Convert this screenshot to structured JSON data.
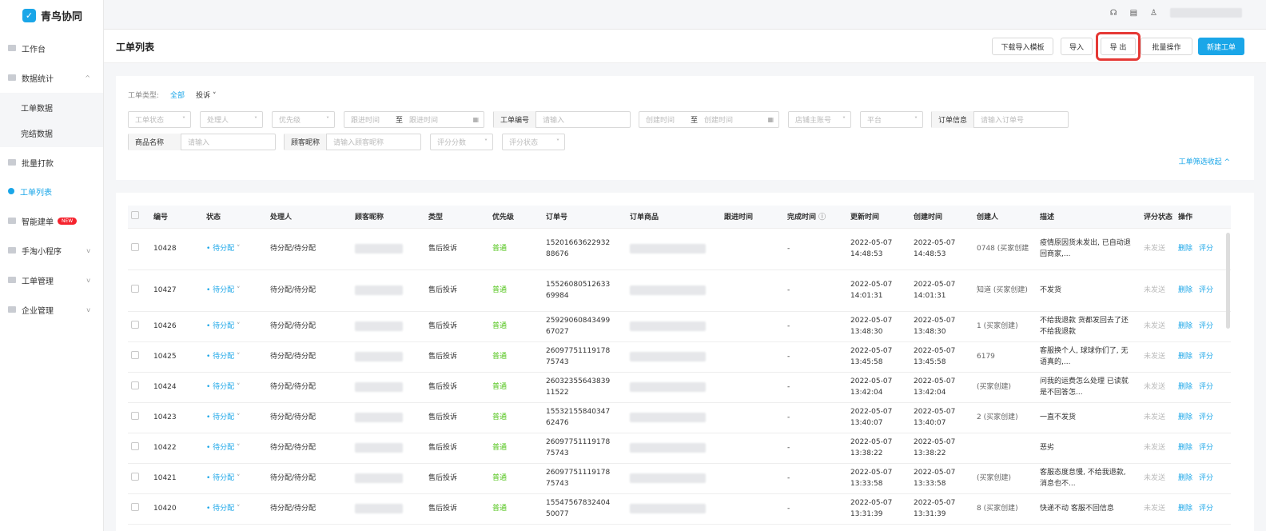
{
  "app": {
    "title": "青鸟协同",
    "logo_char": "✓"
  },
  "sidebar": {
    "items": [
      {
        "label": "工作台"
      },
      {
        "label": "数据统计",
        "chev": "^"
      },
      {
        "label": "工单数据"
      },
      {
        "label": "完结数据"
      },
      {
        "label": "批量打款"
      },
      {
        "label": "工单列表"
      },
      {
        "label": "智能建单",
        "badge": "NEW"
      },
      {
        "label": "手淘小程序",
        "chev": "v"
      },
      {
        "label": "工单管理",
        "chev": "v"
      },
      {
        "label": "企业管理",
        "chev": "v"
      }
    ]
  },
  "header": {
    "title": "工单列表",
    "buttons": {
      "download": "下载导入模板",
      "import": "导入",
      "export": "导 出",
      "batch": "批量操作",
      "new": "新建工单"
    }
  },
  "filters": {
    "type_label": "工单类型:",
    "type_all": "全部",
    "type_complaint": "投诉",
    "status_ph": "工单状态",
    "handler_ph": "处理人",
    "priority_ph": "优先级",
    "follow_start": "跟进时间",
    "follow_to": "至",
    "follow_end": "跟进时间",
    "wo_no_label": "工单编号",
    "wo_no_ph": "请输入",
    "create_start": "创建时间",
    "create_to": "至",
    "create_end": "创建时间",
    "shop_ph": "店铺主账号",
    "platform_ph": "平台",
    "order_label": "订单信息",
    "order_ph": "请输入订单号",
    "product_label": "商品名称",
    "product_ph": "请输入",
    "nick_label": "顾客昵称",
    "nick_ph": "请输入顾客昵称",
    "score_ph": "评分分数",
    "score_status_ph": "评分状态",
    "collapse": "工单筛选收起 ^"
  },
  "table": {
    "headers": [
      "",
      "编号",
      "状态",
      "处理人",
      "顾客昵称",
      "类型",
      "优先级",
      "订单号",
      "订单商品",
      "跟进时间",
      "完成时间",
      "更新时间",
      "创建时间",
      "创建人",
      "描述",
      "评分状态",
      "操作"
    ],
    "rows": [
      {
        "id": "10428",
        "status": "• 待分配",
        "handler": "待分配/待分配",
        "type": "售后投诉",
        "priority": "普通",
        "order": "15201663622932\n88676",
        "follow": "",
        "done": "-",
        "updated": "2022-05-07\n14:48:53",
        "created": "2022-05-07\n14:48:53",
        "creator": "0748 (买家创建",
        "desc": "疫情原因货未发出, 已自动退回商家,...",
        "score": "未发送",
        "del": "删除",
        "rate": "评分"
      },
      {
        "id": "10427",
        "status": "• 待分配",
        "handler": "待分配/待分配",
        "type": "售后投诉",
        "priority": "普通",
        "order": "15526080512633\n69984",
        "follow": "",
        "done": "-",
        "updated": "2022-05-07\n14:01:31",
        "created": "2022-05-07\n14:01:31",
        "creator": "知道 (买家创建)",
        "desc": "不发货",
        "score": "未发送",
        "del": "删除",
        "rate": "评分"
      },
      {
        "id": "10426",
        "status": "• 待分配",
        "handler": "待分配/待分配",
        "type": "售后投诉",
        "priority": "普通",
        "order": "25929060843499\n67027",
        "follow": "",
        "done": "-",
        "updated": "2022-05-07\n13:48:30",
        "created": "2022-05-07\n13:48:30",
        "creator": "1 (买家创建)",
        "desc": "不给我退款 货都发回去了还不给我退款",
        "score": "未发送",
        "del": "删除",
        "rate": "评分"
      },
      {
        "id": "10425",
        "status": "• 待分配",
        "handler": "待分配/待分配",
        "type": "售后投诉",
        "priority": "普通",
        "order": "26097751119178\n75743",
        "follow": "",
        "done": "-",
        "updated": "2022-05-07\n13:45:58",
        "created": "2022-05-07\n13:45:58",
        "creator": "6179",
        "desc": "客服换个人, 球球你们了, 无语真的,...",
        "score": "未发送",
        "del": "删除",
        "rate": "评分"
      },
      {
        "id": "10424",
        "status": "• 待分配",
        "handler": "待分配/待分配",
        "type": "售后投诉",
        "priority": "普通",
        "order": "26032355643839\n11522",
        "follow": "",
        "done": "-",
        "updated": "2022-05-07\n13:42:04",
        "created": "2022-05-07\n13:42:04",
        "creator": "(买家创建)",
        "desc": "问我的运费怎么处理 已读就是不回答怎...",
        "score": "未发送",
        "del": "删除",
        "rate": "评分"
      },
      {
        "id": "10423",
        "status": "• 待分配",
        "handler": "待分配/待分配",
        "type": "售后投诉",
        "priority": "普通",
        "order": "15532155840347\n62476",
        "follow": "",
        "done": "-",
        "updated": "2022-05-07\n13:40:07",
        "created": "2022-05-07\n13:40:07",
        "creator": "2 (买家创建)",
        "desc": "一直不发货",
        "score": "未发送",
        "del": "删除",
        "rate": "评分"
      },
      {
        "id": "10422",
        "status": "• 待分配",
        "handler": "待分配/待分配",
        "type": "售后投诉",
        "priority": "普通",
        "order": "26097751119178\n75743",
        "follow": "",
        "done": "-",
        "updated": "2022-05-07\n13:38:22",
        "created": "2022-05-07\n13:38:22",
        "creator": "",
        "desc": "恶劣",
        "score": "未发送",
        "del": "删除",
        "rate": "评分"
      },
      {
        "id": "10421",
        "status": "• 待分配",
        "handler": "待分配/待分配",
        "type": "售后投诉",
        "priority": "普通",
        "order": "26097751119178\n75743",
        "follow": "",
        "done": "-",
        "updated": "2022-05-07\n13:33:58",
        "created": "2022-05-07\n13:33:58",
        "creator": "(买家创建)",
        "desc": "客服态度怠慢, 不给我退款, 消息也不...",
        "score": "未发送",
        "del": "删除",
        "rate": "评分"
      },
      {
        "id": "10420",
        "status": "• 待分配",
        "handler": "待分配/待分配",
        "type": "售后投诉",
        "priority": "普通",
        "order": "15547567832404\n50077",
        "follow": "",
        "done": "-",
        "updated": "2022-05-07\n13:31:39",
        "created": "2022-05-07\n13:31:39",
        "creator": "8 (买家创建)",
        "desc": "快递不动 客服不回信息",
        "score": "未发送",
        "del": "删除",
        "rate": "评分"
      }
    ]
  }
}
